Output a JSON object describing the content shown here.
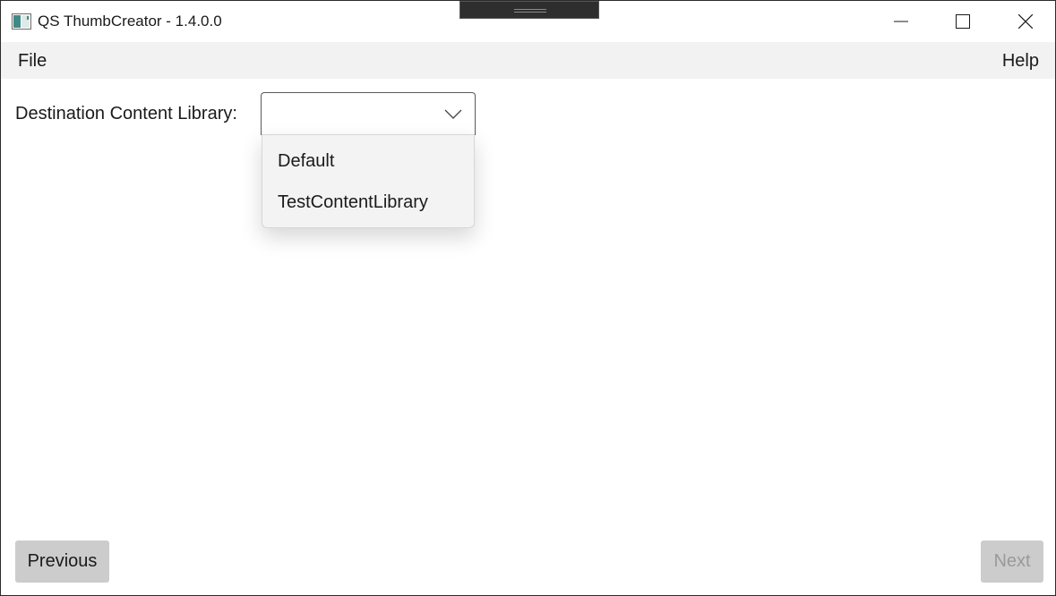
{
  "window": {
    "title": "QS ThumbCreator - 1.4.0.0",
    "icon": "app-window-icon"
  },
  "titlebar_buttons": {
    "minimize_icon": "minimize-icon",
    "maximize_icon": "maximize-icon",
    "close_icon": "close-icon"
  },
  "menu": {
    "file": "File",
    "help": "Help"
  },
  "form": {
    "destination_label": "Destination Content Library:",
    "destination_value": "",
    "chevron_icon": "chevron-down-icon",
    "options": [
      {
        "label": "Default"
      },
      {
        "label": "TestContentLibrary"
      }
    ]
  },
  "footer": {
    "previous_label": "Previous",
    "next_label": "Next",
    "next_enabled": false
  },
  "colors": {
    "menubar_bg": "#f2f2f2",
    "button_bg": "#cccccc",
    "disabled_text": "#9a9a9a"
  }
}
